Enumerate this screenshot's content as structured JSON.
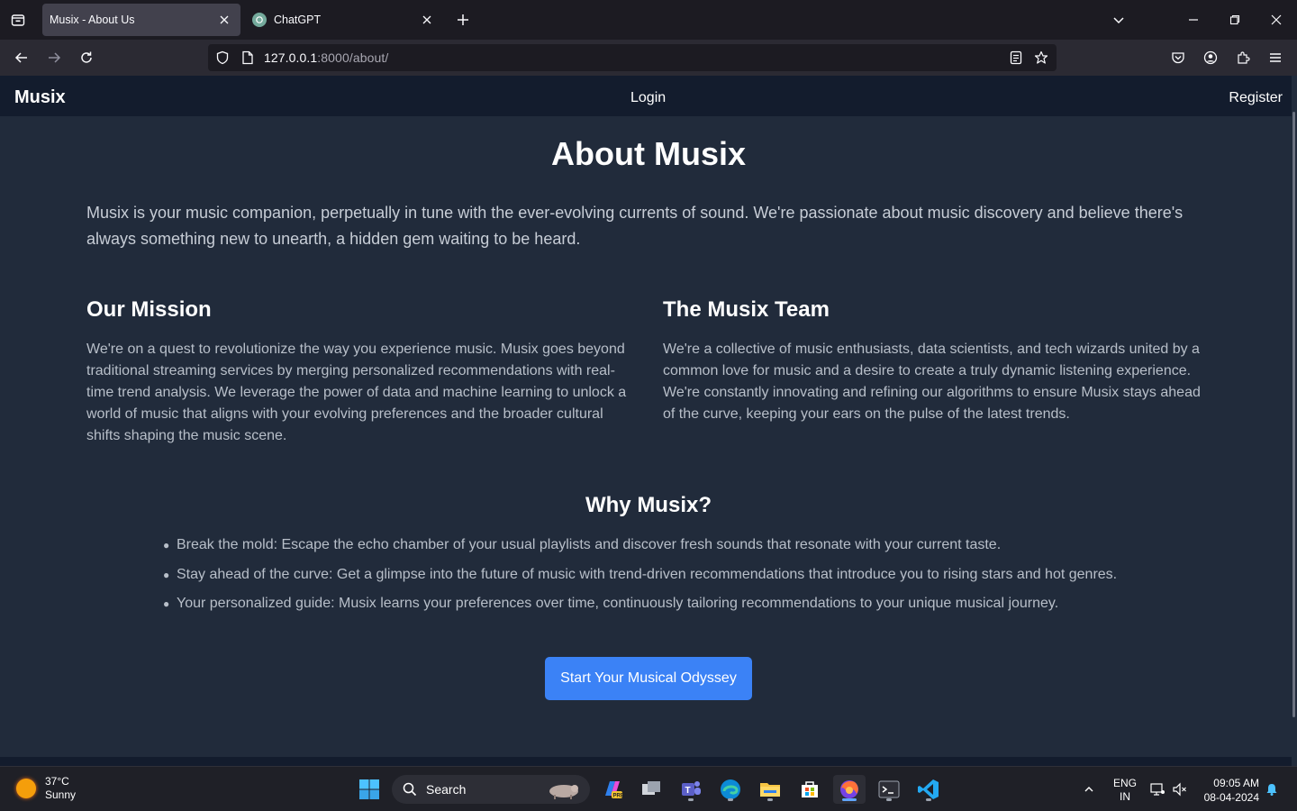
{
  "browser": {
    "tabs": [
      {
        "title": "Musix - About Us",
        "active": true
      },
      {
        "title": "ChatGPT",
        "active": false
      }
    ],
    "url_host": "127.0.0.1",
    "url_rest": ":8000/about/"
  },
  "site": {
    "brand": "Musix",
    "nav": {
      "login": "Login",
      "register": "Register"
    }
  },
  "about": {
    "title": "About Musix",
    "intro": "Musix is your music companion, perpetually in tune with the ever-evolving currents of sound. We're passionate about music discovery and believe there's always something new to unearth, a hidden gem waiting to be heard.",
    "mission": {
      "title": "Our Mission",
      "text": "We're on a quest to revolutionize the way you experience music. Musix goes beyond traditional streaming services by merging personalized recommendations with real-time trend analysis. We leverage the power of data and machine learning to unlock a world of music that aligns with your evolving preferences and the broader cultural shifts shaping the music scene."
    },
    "team": {
      "title": "The Musix Team",
      "text": "We're a collective of music enthusiasts, data scientists, and tech wizards united by a common love for music and a desire to create a truly dynamic listening experience. We're constantly innovating and refining our algorithms to ensure Musix stays ahead of the curve, keeping your ears on the pulse of the latest trends."
    },
    "why": {
      "title": "Why Musix?",
      "items": [
        "Break the mold: Escape the echo chamber of your usual playlists and discover fresh sounds that resonate with your current taste.",
        "Stay ahead of the curve: Get a glimpse into the future of music with trend-driven recommendations that introduce you to rising stars and hot genres.",
        "Your personalized guide: Musix learns your preferences over time, continuously tailoring recommendations to your unique musical journey."
      ]
    },
    "cta": "Start Your Musical Odyssey"
  },
  "taskbar": {
    "weather": {
      "temp": "37°C",
      "condition": "Sunny"
    },
    "search_label": "Search",
    "lang": {
      "line1": "ENG",
      "line2": "IN"
    },
    "clock": {
      "time": "09:05 AM",
      "date": "08-04-2024"
    }
  },
  "colors": {
    "page_bg": "#212b3b",
    "header_bg": "#131c2d",
    "cta_bg": "#3b82f6"
  }
}
